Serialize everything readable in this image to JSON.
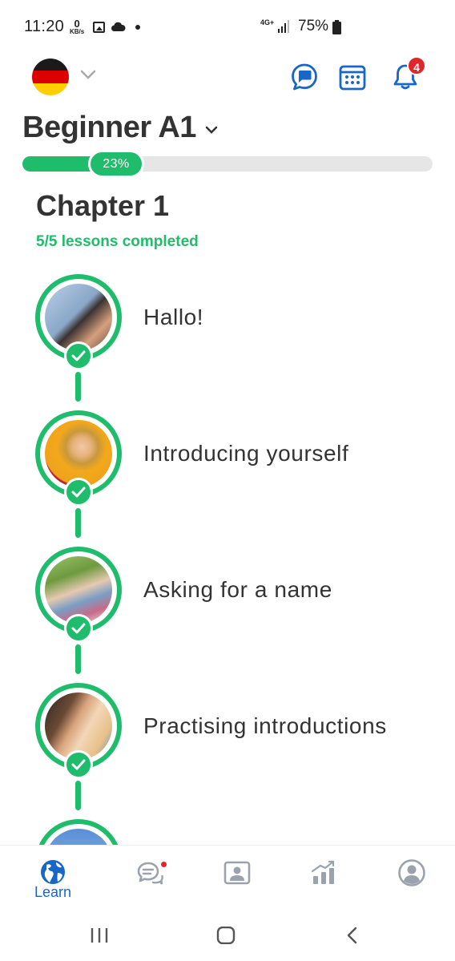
{
  "status_bar": {
    "time": "11:20",
    "data_rate_value": "0",
    "data_rate_unit": "KB/s",
    "network": "4G+",
    "battery": "75%"
  },
  "header": {
    "language_flag": "germany-flag",
    "notification_count": "4",
    "icons": [
      "chat-bubble-icon",
      "calendar-icon",
      "bell-icon"
    ]
  },
  "course": {
    "title": "Beginner A1",
    "progress_label": "23%",
    "progress_value": 0.23
  },
  "chapter": {
    "title": "Chapter 1",
    "subtitle": "5/5 lessons completed"
  },
  "lessons": [
    {
      "label": "Hallo!",
      "completed": true
    },
    {
      "label": "Introducing yourself",
      "completed": true
    },
    {
      "label": "Asking for a name",
      "completed": true
    },
    {
      "label": "Practising introductions",
      "completed": true
    }
  ],
  "bottom_nav": {
    "items": [
      {
        "label": "Learn",
        "icon": "globe-icon",
        "active": true
      },
      {
        "label": "",
        "icon": "chat-icon",
        "active": false
      },
      {
        "label": "",
        "icon": "teacher-icon",
        "active": false
      },
      {
        "label": "",
        "icon": "stats-icon",
        "active": false
      },
      {
        "label": "",
        "icon": "profile-icon",
        "active": false
      }
    ]
  },
  "colors": {
    "accent_green": "#1fbd6b",
    "accent_blue": "#1766c8",
    "badge_red": "#e0262a",
    "text_dark": "#333333"
  }
}
